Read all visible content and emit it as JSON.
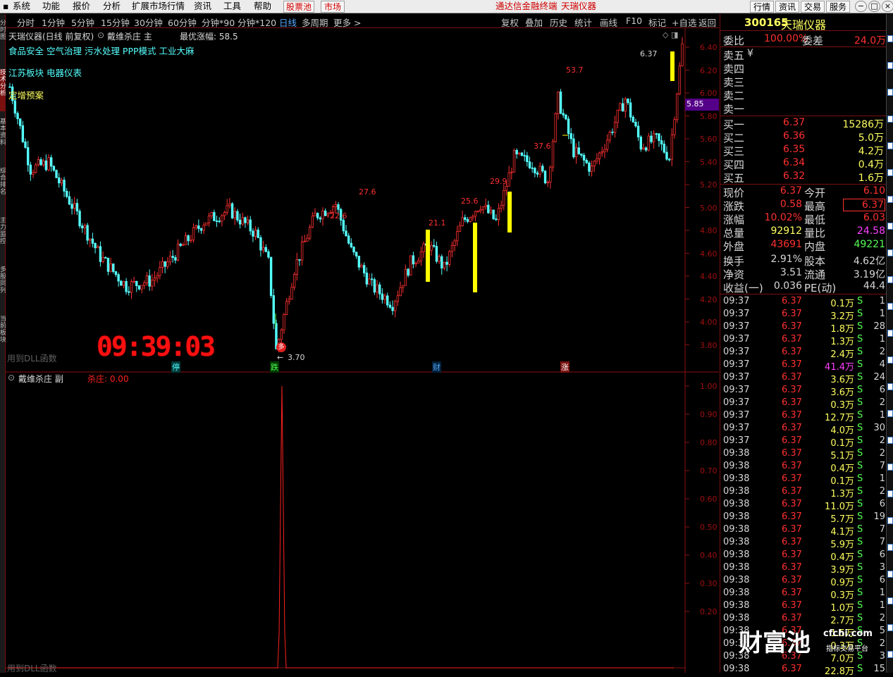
{
  "menu": {
    "items": [
      "系统",
      "功能",
      "报价",
      "分析",
      "扩展市场行情",
      "资讯",
      "工具",
      "帮助"
    ],
    "stock_pool": "股票池",
    "market": "市场",
    "title": "通达信金融终端",
    "title_stock": "天瑞仪器",
    "right_buttons": [
      "行情",
      "资讯",
      "交易",
      "服务"
    ]
  },
  "periods": {
    "items": [
      "分时",
      "1分钟",
      "5分钟",
      "15分钟",
      "30分钟",
      "60分钟",
      "分钟*90",
      "分钟*120",
      "日线",
      "多周期",
      "更多 >"
    ],
    "active": "日线",
    "tools": [
      "复权",
      "叠加",
      "历史",
      "统计",
      "画线",
      "F10",
      "标记",
      "+自选",
      "返回"
    ]
  },
  "left_tabs": [
    "分时图",
    "技术分析",
    "基本资料",
    "综合排名",
    "主力监控",
    "多股同列",
    "当前板块"
  ],
  "chart_header": {
    "stock_label": "天瑞仪器(日线 前复权)",
    "indicator": "戴维杀庄 主",
    "best_gain": "最优涨幅: 58.5",
    "concepts_line1": "食品安全 空气治理 污水处理 PPP模式 工业大麻",
    "concepts_line2": "江苏板块  电器仪表",
    "concepts_line3": "定增预案"
  },
  "main_chart": {
    "y_ticks": [
      "6.40",
      "6.20",
      "6.00",
      "5.80",
      "5.60",
      "5.40",
      "5.20",
      "5.00",
      "4.80",
      "4.60",
      "4.40",
      "4.20",
      "4.00",
      "3.80"
    ],
    "current_price_tag": "5.85",
    "peak_labels": [
      "53.7",
      "37.6",
      "29.9",
      "25.6",
      "21.1",
      "22.6",
      "27.6"
    ],
    "high_label": "6.37",
    "low_label": "3.70",
    "signal_tag": "多",
    "clock": "09:39:03",
    "footer": "用到DLL函数",
    "x_markers": [
      "停",
      "跌",
      "财",
      "涨"
    ]
  },
  "sub_chart": {
    "indicator": "戴维杀庄 副",
    "value_label": "杀庄: 0.00",
    "y_ticks": [
      "1.00",
      "0.90",
      "0.80",
      "0.70",
      "0.60",
      "0.50",
      "0.40",
      "0.30",
      "0.20"
    ],
    "footer": "用到DLL函数"
  },
  "quote": {
    "code": "300165",
    "name": "天瑞仪器",
    "weibi_label": "委比",
    "weibi": "100.00%",
    "weicha_label": "委差",
    "weicha": "24.0万",
    "sell_labels": [
      "卖五",
      "卖四",
      "卖三",
      "卖二",
      "卖一"
    ],
    "sell5_mark": "¥",
    "buys": [
      {
        "label": "买一",
        "price": "6.37",
        "vol": "15286万"
      },
      {
        "label": "买二",
        "price": "6.36",
        "vol": "5.0万"
      },
      {
        "label": "买三",
        "price": "6.35",
        "vol": "4.2万"
      },
      {
        "label": "买四",
        "price": "6.34",
        "vol": "0.4万"
      },
      {
        "label": "买五",
        "price": "6.32",
        "vol": "1.6万"
      }
    ],
    "stats": [
      {
        "l1": "现价",
        "v1": "6.37",
        "l2": "今开",
        "v2": "6.10"
      },
      {
        "l1": "涨跌",
        "v1": "0.58",
        "l2": "最高",
        "v2": "6.37"
      },
      {
        "l1": "涨幅",
        "v1": "10.02%",
        "l2": "最低",
        "v2": "6.03"
      },
      {
        "l1": "总量",
        "v1": "92912",
        "l2": "量比",
        "v2": "24.58"
      },
      {
        "l1": "外盘",
        "v1": "43691",
        "l2": "内盘",
        "v2": "49221"
      },
      {
        "l1": "换手",
        "v1": "2.91%",
        "l2": "股本",
        "v2": "4.62亿"
      },
      {
        "l1": "净资",
        "v1": "3.51",
        "l2": "流通",
        "v2": "3.19亿"
      },
      {
        "l1": "收益(一)",
        "v1": "0.036",
        "l2": "PE(动)",
        "v2": "44.4"
      }
    ]
  },
  "ticks": [
    {
      "t": "09:37",
      "p": "6.37",
      "v": "0.1万",
      "s": "S",
      "n": "1"
    },
    {
      "t": "09:37",
      "p": "6.37",
      "v": "3.2万",
      "s": "S",
      "n": "1"
    },
    {
      "t": "09:37",
      "p": "6.37",
      "v": "1.8万",
      "s": "S",
      "n": "28"
    },
    {
      "t": "09:37",
      "p": "6.37",
      "v": "1.3万",
      "s": "S",
      "n": "1"
    },
    {
      "t": "09:37",
      "p": "6.37",
      "v": "2.4万",
      "s": "S",
      "n": "2"
    },
    {
      "t": "09:37",
      "p": "6.37",
      "v": "41.4万",
      "s": "S",
      "n": "4",
      "hl": true
    },
    {
      "t": "09:37",
      "p": "6.37",
      "v": "3.6万",
      "s": "S",
      "n": "24"
    },
    {
      "t": "09:37",
      "p": "6.37",
      "v": "3.6万",
      "s": "S",
      "n": "6"
    },
    {
      "t": "09:37",
      "p": "6.37",
      "v": "0.3万",
      "s": "S",
      "n": "2"
    },
    {
      "t": "09:37",
      "p": "6.37",
      "v": "12.7万",
      "s": "S",
      "n": "1"
    },
    {
      "t": "09:37",
      "p": "6.37",
      "v": "4.0万",
      "s": "S",
      "n": "30"
    },
    {
      "t": "09:37",
      "p": "6.37",
      "v": "0.1万",
      "s": "S",
      "n": "2"
    },
    {
      "t": "09:38",
      "p": "6.37",
      "v": "5.1万",
      "s": "S",
      "n": "2"
    },
    {
      "t": "09:38",
      "p": "6.37",
      "v": "0.4万",
      "s": "S",
      "n": "7"
    },
    {
      "t": "09:38",
      "p": "6.37",
      "v": "0.1万",
      "s": "S",
      "n": "1"
    },
    {
      "t": "09:38",
      "p": "6.37",
      "v": "1.3万",
      "s": "S",
      "n": "2"
    },
    {
      "t": "09:38",
      "p": "6.37",
      "v": "11.0万",
      "s": "S",
      "n": "6"
    },
    {
      "t": "09:38",
      "p": "6.37",
      "v": "5.7万",
      "s": "S",
      "n": "19"
    },
    {
      "t": "09:38",
      "p": "6.37",
      "v": "4.1万",
      "s": "S",
      "n": "7"
    },
    {
      "t": "09:38",
      "p": "6.37",
      "v": "5.9万",
      "s": "S",
      "n": "7"
    },
    {
      "t": "09:38",
      "p": "6.37",
      "v": "0.4万",
      "s": "S",
      "n": "6"
    },
    {
      "t": "09:38",
      "p": "6.37",
      "v": "3.9万",
      "s": "S",
      "n": "3"
    },
    {
      "t": "09:38",
      "p": "6.37",
      "v": "0.9万",
      "s": "S",
      "n": "6"
    },
    {
      "t": "09:38",
      "p": "6.37",
      "v": "0.3万",
      "s": "S",
      "n": "1"
    },
    {
      "t": "09:38",
      "p": "6.37",
      "v": "1.0万",
      "s": "S",
      "n": "1"
    },
    {
      "t": "09:38",
      "p": "6.37",
      "v": "2.7万",
      "s": "S",
      "n": "2"
    },
    {
      "t": "09:38",
      "p": "6.37",
      "v": "1.5万",
      "s": "S",
      "n": "5"
    },
    {
      "t": "09:38",
      "p": "6.37",
      "v": "0.3万",
      "s": "S",
      "n": "2"
    },
    {
      "t": "09:38",
      "p": "6.37",
      "v": "7.0万",
      "s": "S",
      "n": "3"
    },
    {
      "t": "09:38",
      "p": "6.37",
      "v": "22.8万",
      "s": "S",
      "n": "15"
    }
  ],
  "watermark": {
    "brand": "财富池",
    "url": "cfchi.com",
    "tag": "指标交易平台"
  },
  "colors": {
    "up": "#ff3030",
    "down": "#54ffff",
    "signal": "#ffff00",
    "axis": "#8c1010",
    "purple": "#550088"
  }
}
